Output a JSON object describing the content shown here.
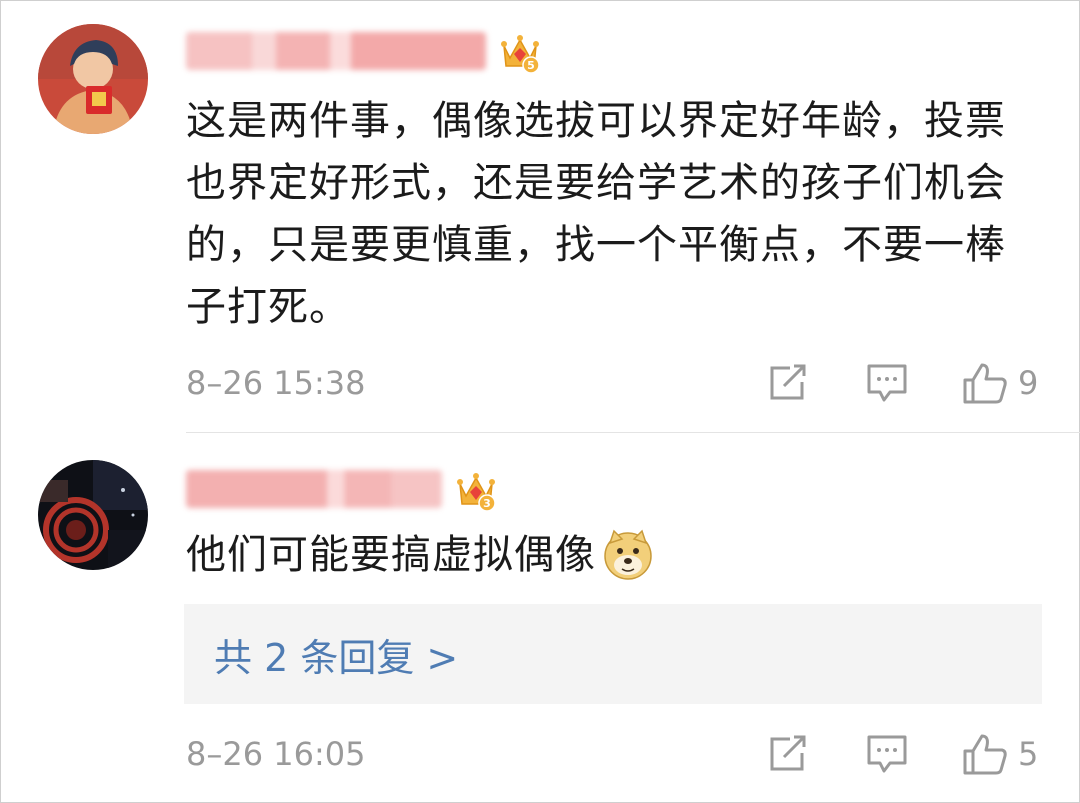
{
  "comments": [
    {
      "text": "这是两件事，偶像选拔可以界定好年龄，投票也界定好形式，还是要给学艺术的孩子们机会的，只是要更慎重，找一个平衡点，不要一棒子打死。",
      "time": "8–26 15:38",
      "likes": "9",
      "badge_level": "5",
      "icons": [
        "avatar",
        "crown-badge-icon",
        "share-icon",
        "comment-icon",
        "like-icon"
      ]
    },
    {
      "text": "他们可能要搞虚拟偶像",
      "time": "8–26 16:05",
      "likes": "5",
      "badge_level": "3",
      "emoji": "doge-emoji-icon",
      "replies_label": "共 2 条回复 >",
      "icons": [
        "avatar",
        "crown-badge-icon",
        "share-icon",
        "comment-icon",
        "like-icon"
      ]
    }
  ],
  "colors": {
    "text": "#1b1b1b",
    "meta": "#9a9a9a",
    "link": "#4f7cb3",
    "blurred_name": "#f4b8b8",
    "reply_bg": "#f4f4f4"
  }
}
